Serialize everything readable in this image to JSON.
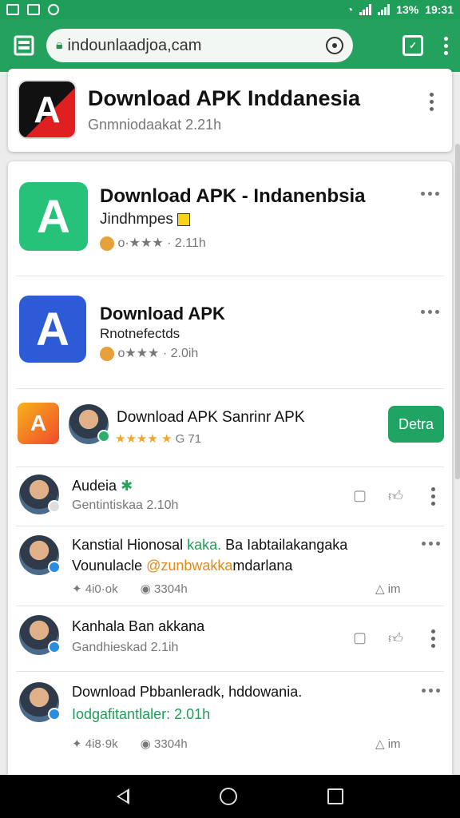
{
  "status_bar": {
    "battery": "13%",
    "time": "19:31"
  },
  "browser": {
    "url": "indounlaadjoa,cam",
    "tabs_icon": "tabs-icon",
    "colors": {
      "toolbar": "#24a25d",
      "status": "#1e9e58"
    }
  },
  "top_card": {
    "title": "Download APK Inddanesia",
    "subtitle": "Gnmniodaakat 2.21h",
    "icon_letter": "A"
  },
  "apps": [
    {
      "title": "Download APK - Indanenbsia",
      "tagline": "Jindhmpes",
      "meta": "o·★★★ · 2.11h",
      "icon_letter": "A",
      "color": "#27c27a"
    },
    {
      "title": "Download APK",
      "tagline": "Rnotnefectds",
      "meta": "o★★★ · 2.0ih",
      "icon_letter": "A",
      "color": "#2d5bd8"
    }
  ],
  "promo": {
    "title": "Download APK Sanrinr APK",
    "rating_text": "G 71",
    "button_label": "Detra"
  },
  "posts": [
    {
      "name": "Audeia",
      "meta": "Gentintiskaa 2.10h",
      "body": "",
      "body2": "",
      "stats": []
    },
    {
      "name": "Kanstial Hionosal",
      "name_accent": "kaka.",
      "name_rest": "Ba Iabtailakangaka",
      "body_prefix": "Vounulacle ",
      "body_accent": "@zunbwakka",
      "body_rest": "mdarlana",
      "stats": [
        "4i0·ok",
        "3304h",
        "im"
      ]
    },
    {
      "name": "Kanhala Ban akkana",
      "meta": "Gandhieskad 2.1ih",
      "stats": []
    },
    {
      "name": "Download Pbbanleradk, hddowania.",
      "body": "Iodgafitantlaler: 2.01h",
      "stats": [
        "4i8·9k",
        "3304h",
        "im"
      ]
    }
  ]
}
